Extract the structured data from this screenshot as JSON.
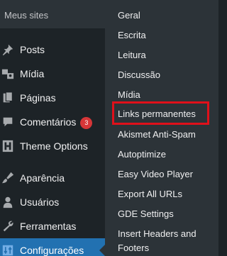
{
  "site": {
    "label": "Meus sites"
  },
  "menu": {
    "items": [
      {
        "label": "Posts",
        "icon": "pin-icon"
      },
      {
        "label": "Mídia",
        "icon": "media-icon"
      },
      {
        "label": "Páginas",
        "icon": "pages-icon"
      },
      {
        "label": "Comentários",
        "icon": "comments-icon",
        "badge": "3"
      },
      {
        "label": "Theme Options",
        "icon": "h-icon"
      },
      {
        "label": "Aparência",
        "icon": "brush-icon"
      },
      {
        "label": "Usuários",
        "icon": "user-icon"
      },
      {
        "label": "Ferramentas",
        "icon": "wrench-icon"
      },
      {
        "label": "Configurações",
        "icon": "settings-icon",
        "active": true
      }
    ]
  },
  "submenu": {
    "items": [
      {
        "label": "Geral"
      },
      {
        "label": "Escrita"
      },
      {
        "label": "Leitura"
      },
      {
        "label": "Discussão"
      },
      {
        "label": "Mídia"
      },
      {
        "label": "Links permanentes",
        "highlighted": true
      },
      {
        "label": "Akismet Anti-Spam"
      },
      {
        "label": "Autoptimize"
      },
      {
        "label": "Easy Video Player"
      },
      {
        "label": "Export All URLs"
      },
      {
        "label": "GDE Settings"
      },
      {
        "label": "Insert Headers and Footers"
      }
    ]
  },
  "colors": {
    "menu_bg": "#1d2327",
    "submenu_bg": "#2c3338",
    "active_bg": "#2271b1",
    "highlight_border": "#e0101a",
    "badge_bg": "#d63638",
    "icon_color": "#a7aaad"
  }
}
